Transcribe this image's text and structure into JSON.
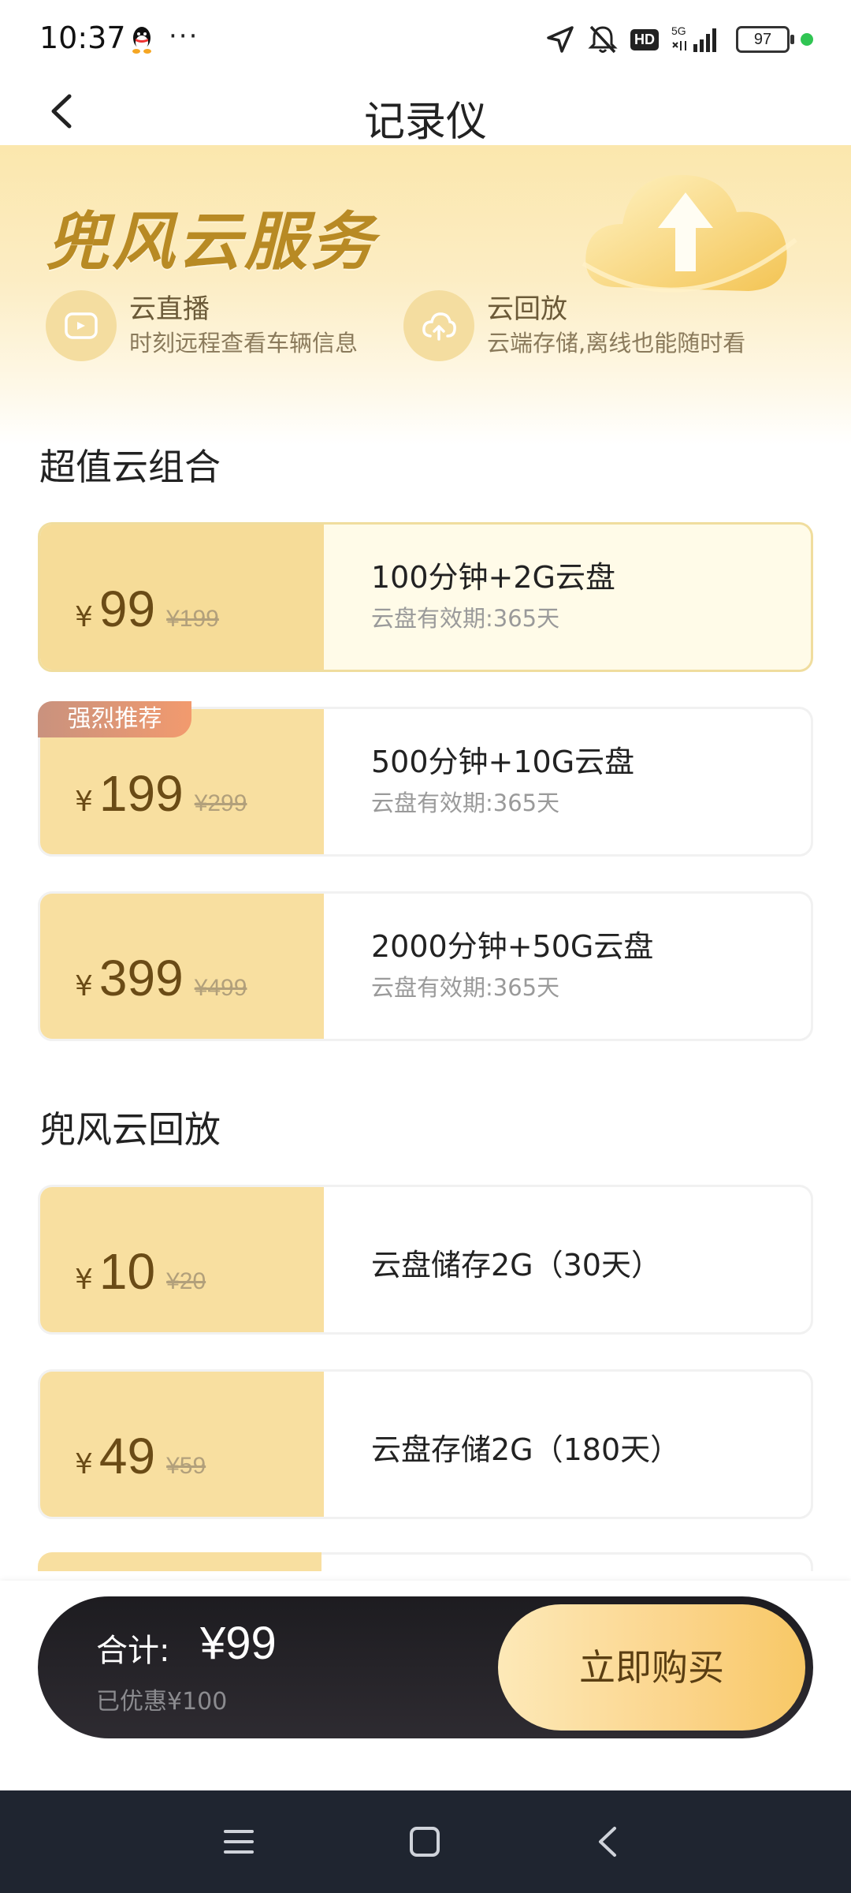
{
  "status_bar": {
    "time": "10:37",
    "dots": "···",
    "hd": "HD",
    "net": "5G",
    "battery": "97"
  },
  "header": {
    "title": "记录仪"
  },
  "hero": {
    "brand": "兜风云服务",
    "features": [
      {
        "title": "云直播",
        "subtitle": "时刻远程查看车辆信息"
      },
      {
        "title": "云回放",
        "subtitle": "云端存储,离线也能随时看"
      }
    ]
  },
  "sections": {
    "combo_title": "超值云组合",
    "playback_title": "兜风云回放"
  },
  "combo_packages": [
    {
      "currency": "¥",
      "price": "99",
      "original": "¥199",
      "title": "100分钟+2G云盘",
      "subtitle": "云盘有效期:365天",
      "selected": true
    },
    {
      "currency": "¥",
      "price": "199",
      "original": "¥299",
      "title": "500分钟+10G云盘",
      "subtitle": "云盘有效期:365天",
      "badge": "强烈推荐"
    },
    {
      "currency": "¥",
      "price": "399",
      "original": "¥499",
      "title": "2000分钟+50G云盘",
      "subtitle": "云盘有效期:365天"
    }
  ],
  "playback_packages": [
    {
      "currency": "¥",
      "price": "10",
      "original": "¥20",
      "title": "云盘储存2G（30天）"
    },
    {
      "currency": "¥",
      "price": "49",
      "original": "¥59",
      "title": "云盘存储2G（180天）"
    }
  ],
  "checkout": {
    "total_label": "合计:",
    "total_amount": "¥99",
    "saved": "已优惠¥100",
    "buy_label": "立即购买"
  },
  "colors": {
    "accent_gold": "#f8dfa0",
    "brand_text": "#b88a24",
    "bar_dark": "#1d1c20",
    "badge": "#f29a6e"
  }
}
